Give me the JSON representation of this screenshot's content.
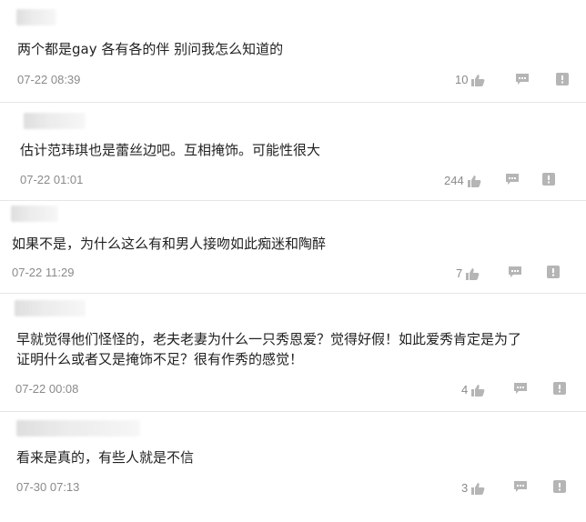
{
  "comments": [
    {
      "text": "两个都是gay 各有各的伴 别问我怎么知道的",
      "time": "07-22 08:39",
      "likes": "10"
    },
    {
      "text": "估计范玮琪也是蕾丝边吧。互相掩饰。可能性很大",
      "time": "07-22 01:01",
      "likes": "244"
    },
    {
      "text": "如果不是，为什么这么有和男人接吻如此痴迷和陶醉",
      "time": "07-22 11:29",
      "likes": "7"
    },
    {
      "text": "早就觉得他们怪怪的，老夫老妻为什么一只秀恩爱？觉得好假！如此爱秀肯定是为了\n证明什么或者又是掩饰不足？很有作秀的感觉！",
      "time": "07-22 00:08",
      "likes": "4"
    },
    {
      "text": "看来是真的，有些人就是不信",
      "time": "07-30 07:13",
      "likes": "3"
    }
  ],
  "icons": {
    "like": "thumbs-up-icon",
    "reply": "reply-bubble-icon",
    "report": "report-flag-icon"
  },
  "colors": {
    "text": "#222222",
    "meta": "#8a8a8a",
    "icon": "#b5b5b5"
  }
}
